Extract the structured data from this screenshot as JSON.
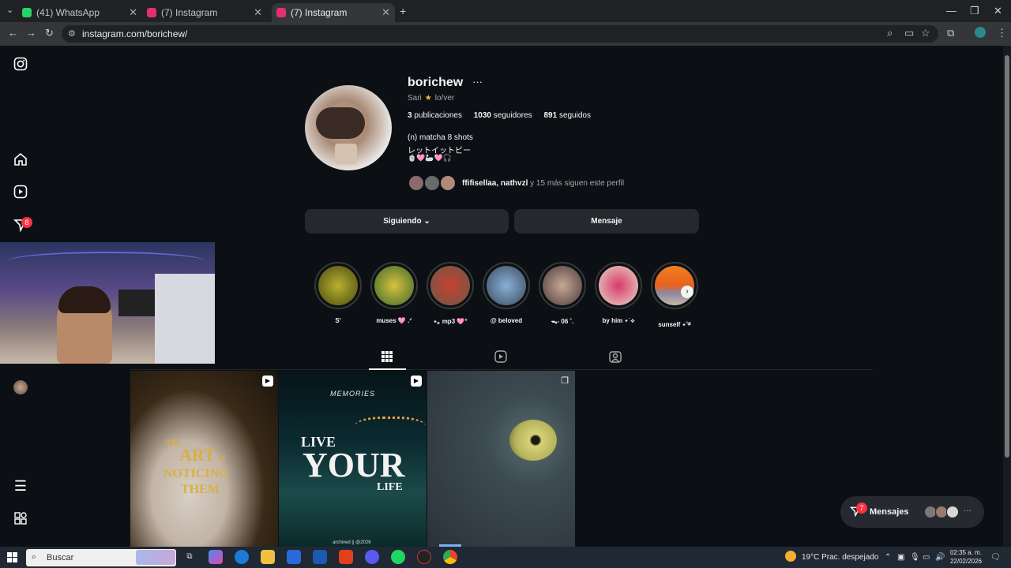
{
  "browser": {
    "tabs": [
      {
        "title": "(41) WhatsApp",
        "favicon_color": "#25d366"
      },
      {
        "title": "(7) Instagram",
        "favicon_color": "#e1306c"
      },
      {
        "title": "(7) Instagram",
        "favicon_color": "#e1306c"
      }
    ],
    "new_tab": "+",
    "url": "instagram.com/borichew/",
    "window_controls": {
      "minimize": "—",
      "restore": "❐",
      "close": "✕"
    }
  },
  "sidebar": {
    "notifications_badge": "8"
  },
  "profile": {
    "username": "borichew",
    "more": "···",
    "name": "Sari",
    "star": "★",
    "pronouns": "lo/ver",
    "posts_count": "3",
    "posts_label": "publicaciones",
    "followers_count": "1030",
    "followers_label": "seguidores",
    "following_count": "891",
    "following_label": "seguidos",
    "bio_line1": "(n) matcha 8 shots",
    "bio_line2": "レットイットビー",
    "bio_line3": "🍵🩷🦢🩷🎧",
    "followed_by_names": "ffifisellaa, nathvzl",
    "followed_by_rest": " y 15 más siguen este perfil",
    "follow_button": "Siguiendo",
    "message_button": "Mensaje"
  },
  "highlights": [
    {
      "label": "S'",
      "color": "#8a8a20"
    },
    {
      "label": "muses 🩷 .ᐟ",
      "color": "#6a8a2a"
    },
    {
      "label": "⋆｡ mp3 🩷°",
      "color": "#8a6a5a"
    },
    {
      "label": "@ beloved",
      "color": "#5a7a9a"
    },
    {
      "label": "ᯓ- 06 ˚.",
      "color": "#9a7a6a"
    },
    {
      "label": "by him ⋆˙⟡",
      "color": "#c86a8a"
    },
    {
      "label": "sunself ⋆˚࿔",
      "color": "#e8782a"
    }
  ],
  "posts": [
    {
      "type_icon": "▶",
      "text_line1": "The",
      "text_line2": "ART",
      "text_line3": "of",
      "text_line4": "NOTICING",
      "text_line5": "THEM"
    },
    {
      "type_icon": "▶",
      "text_top": "MEMORIES",
      "text_live": "LIVE",
      "text_your": "YOUR",
      "text_life": "LIFE",
      "text_bottom": "archived || @2026"
    },
    {
      "type_icon": "❐"
    }
  ],
  "messages": {
    "label": "Mensajes",
    "badge": "7",
    "more": "···"
  },
  "taskbar": {
    "search_placeholder": "Buscar",
    "weather": "19°C  Prac. despejado",
    "time": "02:35 a. m.",
    "date": "22/02/2026"
  }
}
